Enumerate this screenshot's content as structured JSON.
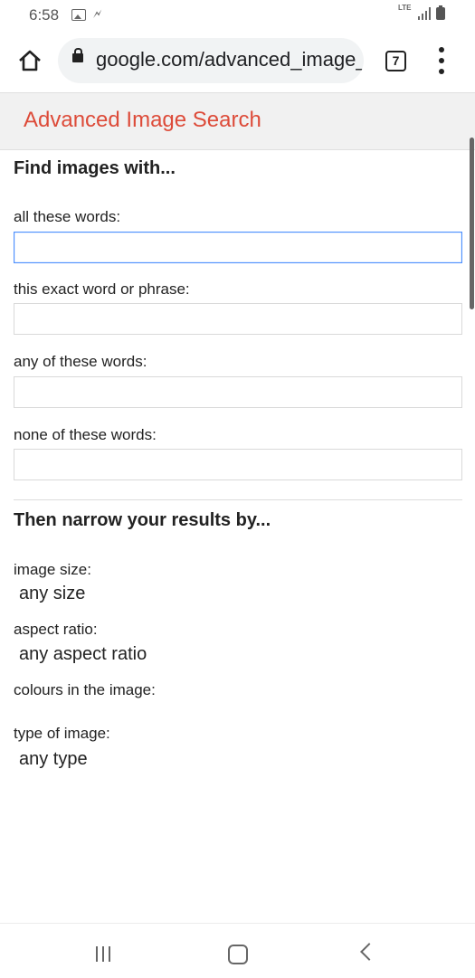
{
  "status": {
    "time": "6:58",
    "network": "LTE"
  },
  "browser": {
    "url": "google.com/advanced_image_search",
    "tab_count": "7"
  },
  "page": {
    "title": "Advanced Image Search"
  },
  "find_section": {
    "title": "Find images with...",
    "fields": [
      {
        "label": "all these words:",
        "value": ""
      },
      {
        "label": "this exact word or phrase:",
        "value": ""
      },
      {
        "label": "any of these words:",
        "value": ""
      },
      {
        "label": "none of these words:",
        "value": ""
      }
    ]
  },
  "narrow_section": {
    "title": "Then narrow your results by...",
    "image_size": {
      "label": "image size:",
      "value": "any size"
    },
    "aspect_ratio": {
      "label": "aspect ratio:",
      "value": "any aspect ratio"
    },
    "colours": {
      "label": "colours in the image:"
    },
    "type": {
      "label": "type of image:",
      "value": "any type"
    }
  },
  "colors": {
    "title_red": "#dd4b39",
    "focus_blue": "#4d90fe"
  }
}
